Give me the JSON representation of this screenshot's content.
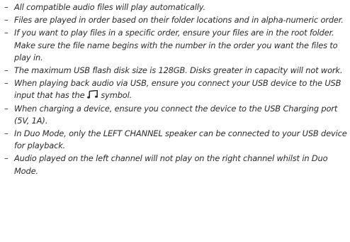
{
  "notes": [
    {
      "text": "All compatible audio files will play automatically."
    },
    {
      "text": "Files are played in order based on their folder locations and in alpha-numeric order."
    },
    {
      "text": "If you want to play files in a specific order, ensure your files are in the root folder. Make sure the file name begins with the number in the order you want the files to play in."
    },
    {
      "text": "The maximum USB flash disk size is 128GB. Disks greater in capacity will not work."
    },
    {
      "before": "When playing back audio via USB, ensure you connect your USB device to the USB input that has the ",
      "icon": "music-note-icon",
      "after": " symbol."
    },
    {
      "text": "When charging a device, ensure you connect the device to the USB Charging port (5V, 1A)."
    },
    {
      "text": "In Duo Mode, only the LEFT CHANNEL speaker can be connected to your USB device for playback."
    },
    {
      "text": "Audio played on the left channel will not play on the right channel whilst in Duo Mode."
    }
  ],
  "bullet": "–"
}
